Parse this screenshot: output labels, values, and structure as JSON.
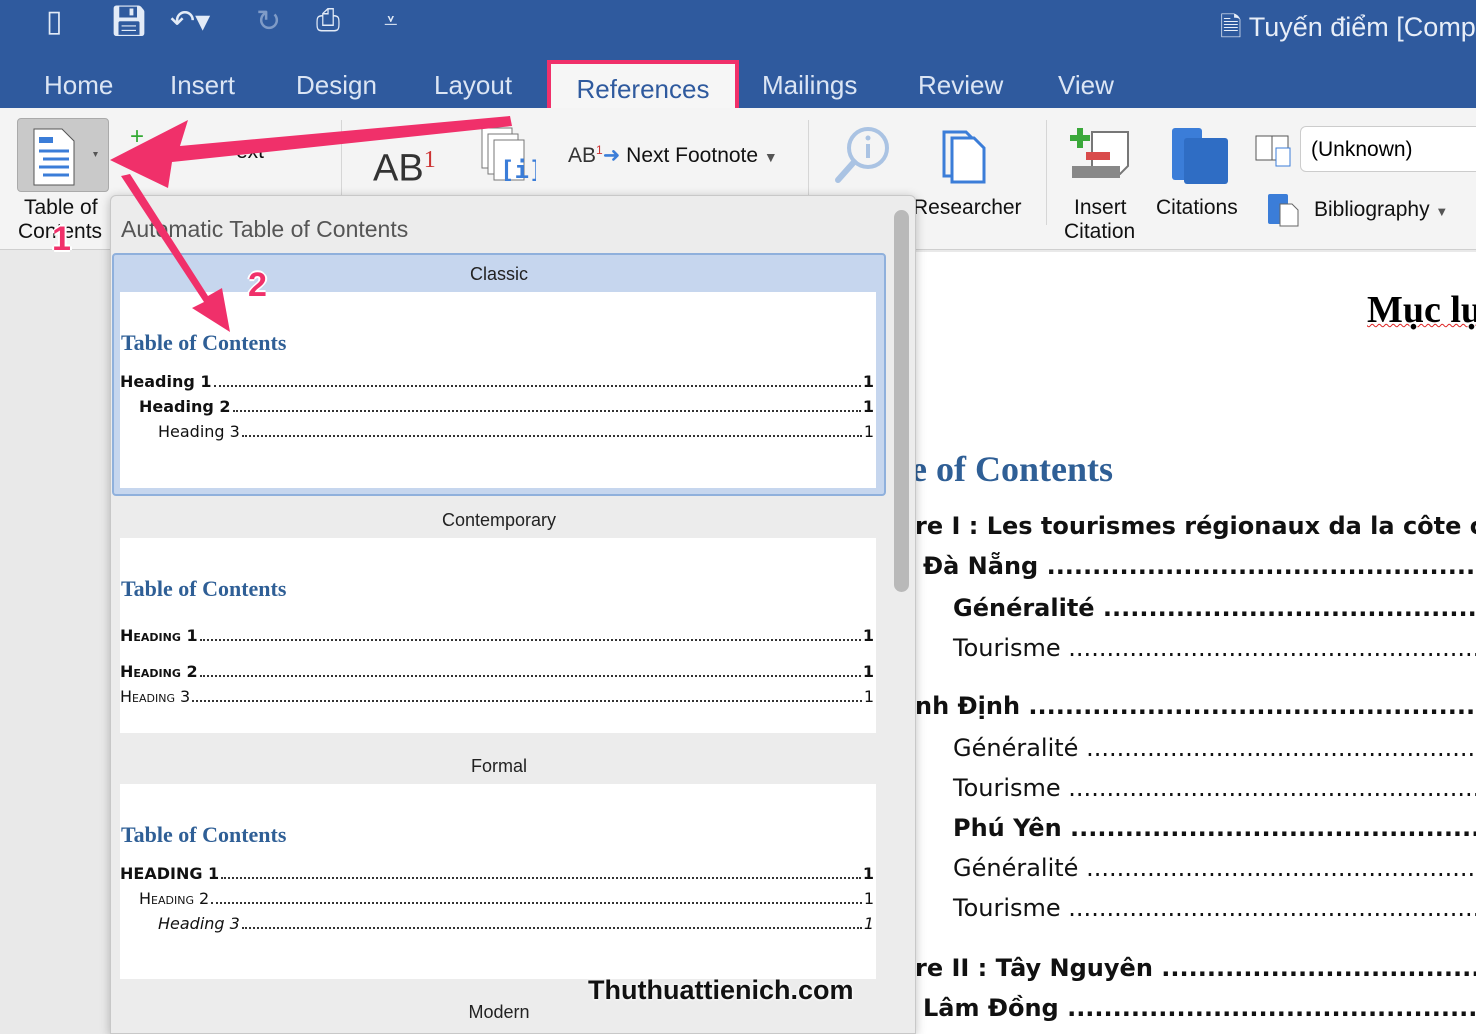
{
  "window": {
    "title": "Tuyến điểm [Comp"
  },
  "quick_access": {
    "icons": [
      "sidebar-icon",
      "save-icon",
      "undo-icon",
      "redo-icon",
      "print-icon",
      "customize-icon"
    ]
  },
  "tabs": [
    {
      "label": "Home"
    },
    {
      "label": "Insert"
    },
    {
      "label": "Design"
    },
    {
      "label": "Layout"
    },
    {
      "label": "References",
      "active": true
    },
    {
      "label": "Mailings"
    },
    {
      "label": "Review"
    },
    {
      "label": "View"
    }
  ],
  "ribbon": {
    "toc_line1": "Table of",
    "toc_line2": "Contents",
    "add_text": "ext",
    "insert_footnote": "AB",
    "footnote_sup": "1",
    "next_footnote": "Next Footnote",
    "researcher": "Researcher",
    "insert_citation_1": "Insert",
    "insert_citation_2": "Citation",
    "citations": "Citations",
    "style_value": "(Unknown)",
    "bibliography": "Bibliography"
  },
  "dropdown": {
    "header": "Automatic Table of Contents",
    "sections": [
      {
        "name": "Classic",
        "title": "Table of Contents",
        "lines": [
          {
            "text": "Heading 1",
            "page": "1"
          },
          {
            "text": "Heading 2",
            "page": "1"
          },
          {
            "text": "Heading 3",
            "page": "1"
          }
        ]
      },
      {
        "name": "Contemporary",
        "title": "Table of Contents",
        "lines": [
          {
            "text": "Heading 1",
            "page": "1"
          },
          {
            "text": "Heading 2",
            "page": "1"
          },
          {
            "text": "Heading 3",
            "page": "1"
          }
        ]
      },
      {
        "name": "Formal",
        "title": "Table of Contents",
        "lines": [
          {
            "text": "HEADING 1",
            "page": "1"
          },
          {
            "text": "Heading 2",
            "page": "1"
          },
          {
            "text": "Heading 3",
            "page": "1"
          }
        ]
      },
      {
        "name": "Modern"
      }
    ]
  },
  "document": {
    "heading": "Mục lục",
    "toc_title": "e of Contents",
    "rows": [
      "re I : Les tourismes régionaux da la côte cen",
      "Đà Nẵng",
      "Généralité",
      "Tourisme",
      "nh Định",
      "Généralité",
      "Tourisme",
      "Phú Yên",
      "Généralité",
      "Tourisme",
      "re II : Tây Nguyên",
      "Lâm Đồng"
    ]
  },
  "annotations": {
    "step1": "1",
    "step2": "2",
    "color": "#f0306a"
  },
  "watermark": "Thuthuattienich.com",
  "colors": {
    "titlebar": "#2f5a9e",
    "accent": "#f0306a",
    "toc_blue": "#2f5f96"
  }
}
